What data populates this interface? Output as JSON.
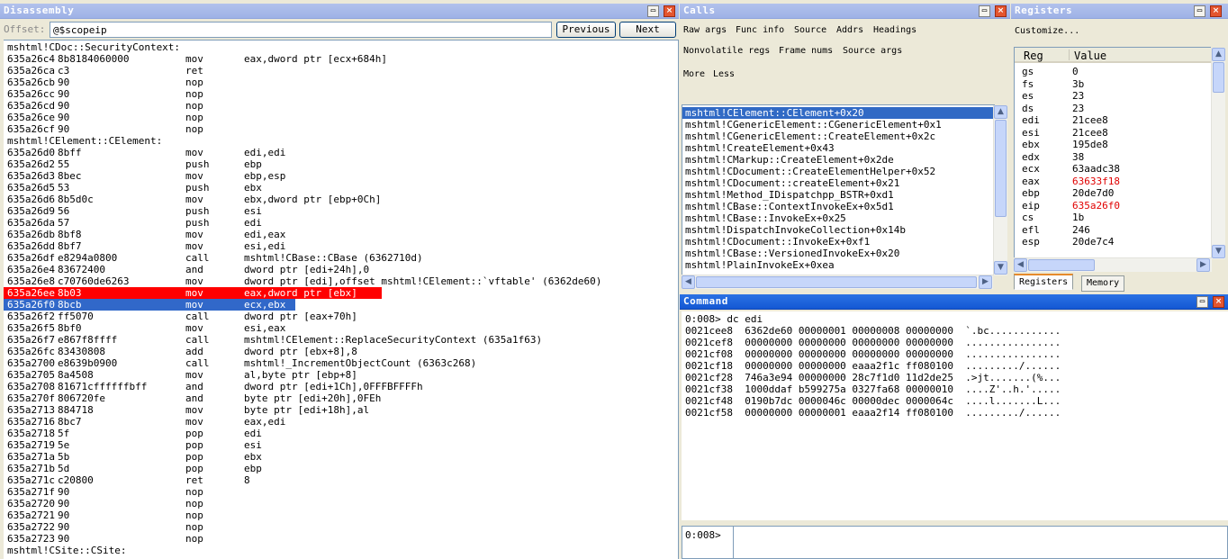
{
  "disassembly": {
    "title": "Disassembly",
    "offset_label": "Offset:",
    "offset_value": "@$scopeip",
    "prev_label": "Previous",
    "next_label": "Next",
    "lines": [
      {
        "t": "label",
        "text": "mshtml!CDoc::SecurityContext:"
      },
      {
        "a": "635a26c4",
        "b": "8b8184060000",
        "m": "mov",
        "o": "eax,dword ptr [ecx+684h]"
      },
      {
        "a": "635a26ca",
        "b": "c3",
        "m": "ret",
        "o": ""
      },
      {
        "a": "635a26cb",
        "b": "90",
        "m": "nop",
        "o": ""
      },
      {
        "a": "635a26cc",
        "b": "90",
        "m": "nop",
        "o": ""
      },
      {
        "a": "635a26cd",
        "b": "90",
        "m": "nop",
        "o": ""
      },
      {
        "a": "635a26ce",
        "b": "90",
        "m": "nop",
        "o": ""
      },
      {
        "a": "635a26cf",
        "b": "90",
        "m": "nop",
        "o": ""
      },
      {
        "t": "label",
        "text": "mshtml!CElement::CElement:"
      },
      {
        "a": "635a26d0",
        "b": "8bff",
        "m": "mov",
        "o": "edi,edi"
      },
      {
        "a": "635a26d2",
        "b": "55",
        "m": "push",
        "o": "ebp"
      },
      {
        "a": "635a26d3",
        "b": "8bec",
        "m": "mov",
        "o": "ebp,esp"
      },
      {
        "a": "635a26d5",
        "b": "53",
        "m": "push",
        "o": "ebx"
      },
      {
        "a": "635a26d6",
        "b": "8b5d0c",
        "m": "mov",
        "o": "ebx,dword ptr [ebp+0Ch]"
      },
      {
        "a": "635a26d9",
        "b": "56",
        "m": "push",
        "o": "esi"
      },
      {
        "a": "635a26da",
        "b": "57",
        "m": "push",
        "o": "edi"
      },
      {
        "a": "635a26db",
        "b": "8bf8",
        "m": "mov",
        "o": "edi,eax"
      },
      {
        "a": "635a26dd",
        "b": "8bf7",
        "m": "mov",
        "o": "esi,edi"
      },
      {
        "a": "635a26df",
        "b": "e8294a0800",
        "m": "call",
        "o": "mshtml!CBase::CBase (6362710d)"
      },
      {
        "a": "635a26e4",
        "b": "83672400",
        "m": "and",
        "o": "dword ptr [edi+24h],0"
      },
      {
        "a": "635a26e8",
        "b": "c70760de6263",
        "m": "mov",
        "o": "dword ptr [edi],offset mshtml!CElement::`vftable' (6362de60)"
      },
      {
        "a": "635a26ee",
        "b": "8b03",
        "m": "mov",
        "o": "eax,dword ptr [ebx]",
        "hl": "red"
      },
      {
        "a": "635a26f0",
        "b": "8bcb",
        "m": "mov",
        "o": "ecx,ebx",
        "hl": "blue"
      },
      {
        "a": "635a26f2",
        "b": "ff5070",
        "m": "call",
        "o": "dword ptr [eax+70h]"
      },
      {
        "a": "635a26f5",
        "b": "8bf0",
        "m": "mov",
        "o": "esi,eax"
      },
      {
        "a": "635a26f7",
        "b": "e867f8ffff",
        "m": "call",
        "o": "mshtml!CElement::ReplaceSecurityContext (635a1f63)"
      },
      {
        "a": "635a26fc",
        "b": "83430808",
        "m": "add",
        "o": "dword ptr [ebx+8],8"
      },
      {
        "a": "635a2700",
        "b": "e8639b0900",
        "m": "call",
        "o": "mshtml!_IncrementObjectCount (6363c268)"
      },
      {
        "a": "635a2705",
        "b": "8a4508",
        "m": "mov",
        "o": "al,byte ptr [ebp+8]"
      },
      {
        "a": "635a2708",
        "b": "81671cffffffbff",
        "m": "and",
        "o": "dword ptr [edi+1Ch],0FFFBFFFFh"
      },
      {
        "a": "635a270f",
        "b": "806720fe",
        "m": "and",
        "o": "byte ptr [edi+20h],0FEh"
      },
      {
        "a": "635a2713",
        "b": "884718",
        "m": "mov",
        "o": "byte ptr [edi+18h],al"
      },
      {
        "a": "635a2716",
        "b": "8bc7",
        "m": "mov",
        "o": "eax,edi"
      },
      {
        "a": "635a2718",
        "b": "5f",
        "m": "pop",
        "o": "edi"
      },
      {
        "a": "635a2719",
        "b": "5e",
        "m": "pop",
        "o": "esi"
      },
      {
        "a": "635a271a",
        "b": "5b",
        "m": "pop",
        "o": "ebx"
      },
      {
        "a": "635a271b",
        "b": "5d",
        "m": "pop",
        "o": "ebp"
      },
      {
        "a": "635a271c",
        "b": "c20800",
        "m": "ret",
        "o": "8"
      },
      {
        "a": "635a271f",
        "b": "90",
        "m": "nop",
        "o": ""
      },
      {
        "a": "635a2720",
        "b": "90",
        "m": "nop",
        "o": ""
      },
      {
        "a": "635a2721",
        "b": "90",
        "m": "nop",
        "o": ""
      },
      {
        "a": "635a2722",
        "b": "90",
        "m": "nop",
        "o": ""
      },
      {
        "a": "635a2723",
        "b": "90",
        "m": "nop",
        "o": ""
      },
      {
        "t": "label",
        "text": "mshtml!CSite::CSite:"
      }
    ]
  },
  "calls": {
    "title": "Calls",
    "options_row1": [
      "Raw args",
      "Func info",
      "Source",
      "Addrs",
      "Headings"
    ],
    "options_row2": [
      "Nonvolatile regs",
      "Frame nums",
      "Source args"
    ],
    "options_row3": [
      "More",
      "Less"
    ],
    "frames": [
      "mshtml!CElement::CElement+0x20",
      "mshtml!CGenericElement::CGenericElement+0x1",
      "mshtml!CGenericElement::CreateElement+0x2c",
      "mshtml!CreateElement+0x43",
      "mshtml!CMarkup::CreateElement+0x2de",
      "mshtml!CDocument::CreateElementHelper+0x52",
      "mshtml!CDocument::createElement+0x21",
      "mshtml!Method_IDispatchpp_BSTR+0xd1",
      "mshtml!CBase::ContextInvokeEx+0x5d1",
      "mshtml!CBase::InvokeEx+0x25",
      "mshtml!DispatchInvokeCollection+0x14b",
      "mshtml!CDocument::InvokeEx+0xf1",
      "mshtml!CBase::VersionedInvokeEx+0x20",
      "mshtml!PlainInvokeEx+0xea"
    ]
  },
  "registers": {
    "title": "Registers",
    "customize_label": "Customize...",
    "col_reg": "Reg",
    "col_value": "Value",
    "rows": [
      {
        "r": "gs",
        "v": "0"
      },
      {
        "r": "fs",
        "v": "3b"
      },
      {
        "r": "es",
        "v": "23"
      },
      {
        "r": "ds",
        "v": "23"
      },
      {
        "r": "edi",
        "v": "21cee8"
      },
      {
        "r": "esi",
        "v": "21cee8"
      },
      {
        "r": "ebx",
        "v": "195de8"
      },
      {
        "r": "edx",
        "v": "38"
      },
      {
        "r": "ecx",
        "v": "63aadc38"
      },
      {
        "r": "eax",
        "v": "63633f18",
        "changed": true
      },
      {
        "r": "ebp",
        "v": "20de7d0"
      },
      {
        "r": "eip",
        "v": "635a26f0",
        "changed": true
      },
      {
        "r": "cs",
        "v": "1b"
      },
      {
        "r": "efl",
        "v": "246"
      },
      {
        "r": "esp",
        "v": "20de7c4"
      }
    ],
    "tabs": [
      "Registers",
      "Memory"
    ]
  },
  "command": {
    "title": "Command",
    "output": [
      "0:008> dc edi",
      "0021cee8  6362de60 00000001 00000008 00000000  `.bc............",
      "0021cef8  00000000 00000000 00000000 00000000  ................",
      "0021cf08  00000000 00000000 00000000 00000000  ................",
      "0021cf18  00000000 00000000 eaaa2f1c ff080100  ........./......",
      "0021cf28  746a3e94 00000000 28c7f1d0 11d2de25  .>jt.......(%...",
      "0021cf38  1000ddaf b599275a 0327fa68 00000010  ....Z'..h.'.....",
      "0021cf48  0190b7dc 0000046c 00000dec 0000064c  ....l.......L...",
      "0021cf58  00000000 00000001 eaaa2f14 ff080100  ........./......"
    ],
    "prompt": "0:008>",
    "input_value": ""
  },
  "colors": {
    "title_active": "#1458d4",
    "title_inactive": "#9eb2e6",
    "highlight_current": "#ff0000",
    "highlight_selection": "#3168c9",
    "register_changed": "#e00000"
  }
}
